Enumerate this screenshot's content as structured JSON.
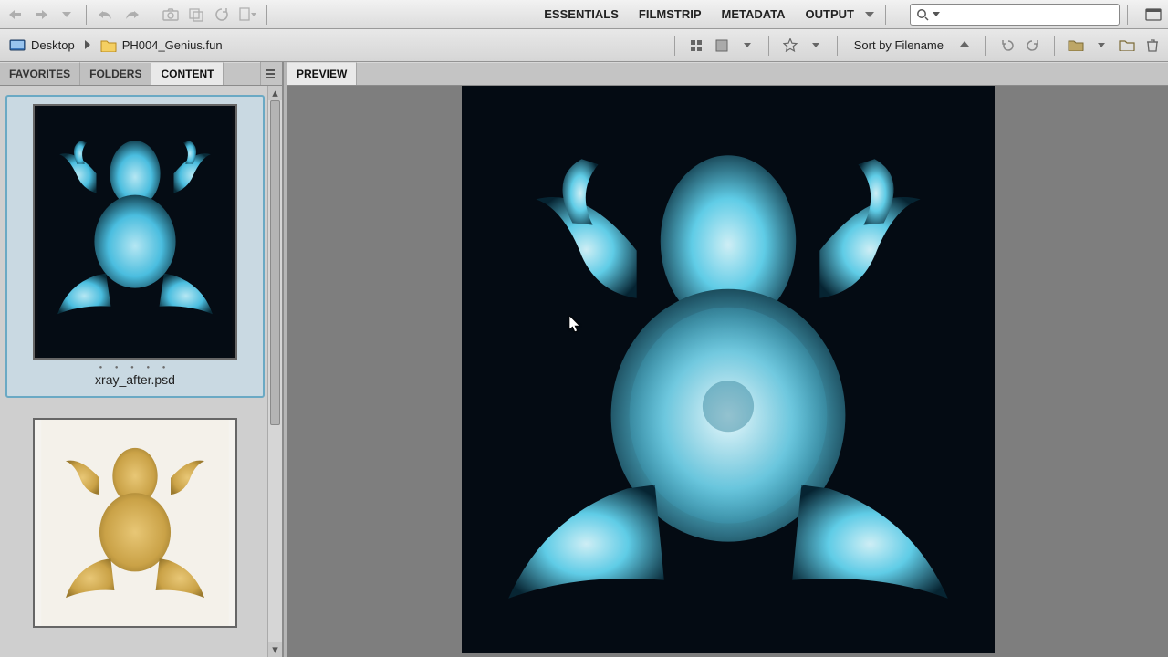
{
  "workspace_tabs": {
    "essentials": "ESSENTIALS",
    "filmstrip": "FILMSTRIP",
    "metadata": "METADATA",
    "output": "OUTPUT"
  },
  "search": {
    "placeholder": ""
  },
  "breadcrumb": {
    "root": "Desktop",
    "folder": "PH004_Genius.fun"
  },
  "sort": {
    "label": "Sort by Filename"
  },
  "left_panel": {
    "tabs": {
      "favorites": "FAVORITES",
      "folders": "FOLDERS",
      "content": "CONTENT"
    },
    "items": [
      {
        "filename": "xray_after.psd",
        "selected": true,
        "style": "xray"
      },
      {
        "filename": "",
        "selected": false,
        "style": "plain"
      }
    ]
  },
  "preview_tab": "PREVIEW"
}
